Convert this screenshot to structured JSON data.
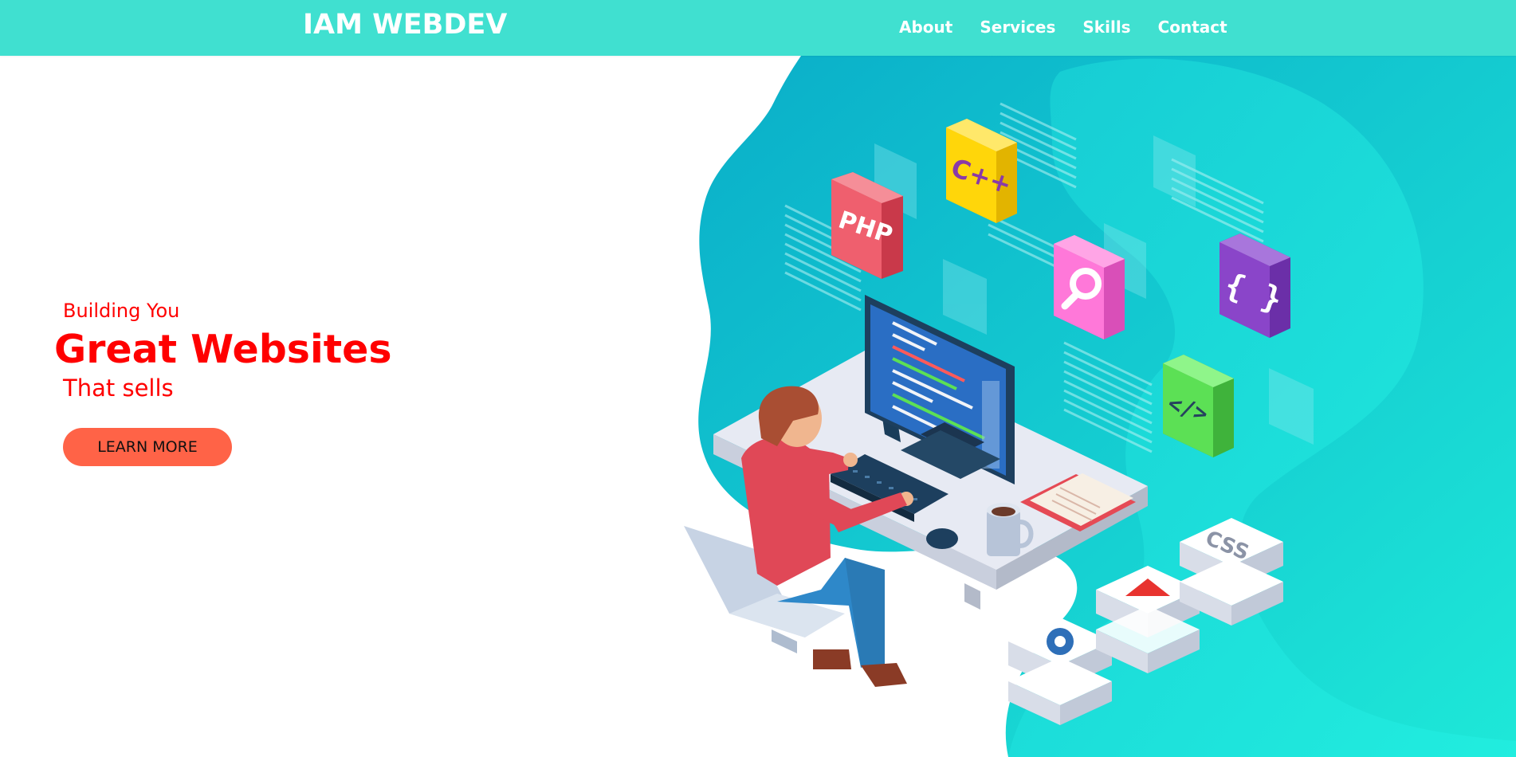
{
  "header": {
    "brand": "IAM WEBDEV",
    "nav": [
      "About",
      "Services",
      "Skills",
      "Contact"
    ]
  },
  "hero": {
    "line1": "Building You",
    "headline": "Great Websites",
    "line3": "That sells",
    "cta_label": "LEARN MORE"
  },
  "illustration": {
    "badges": [
      "PHP",
      "C++",
      "{ }",
      "</>",
      "CSS"
    ]
  },
  "colors": {
    "header_bg": "#40e0d0",
    "accent_red": "#ff0000",
    "cta_bg": "#ff6347",
    "teal_dark": "#0aaec9",
    "teal_light": "#1de9d8"
  }
}
